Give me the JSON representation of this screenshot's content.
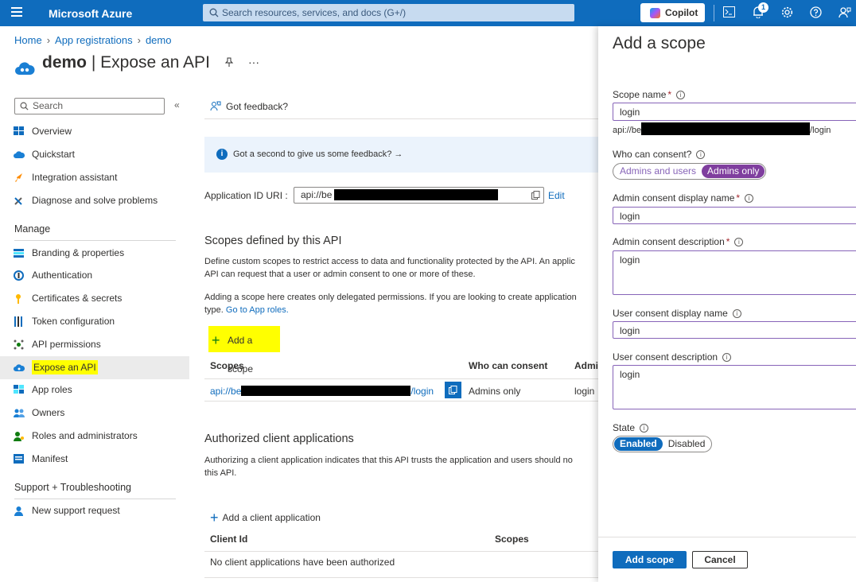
{
  "topbar": {
    "brand": "Microsoft Azure",
    "search_placeholder": "Search resources, services, and docs (G+/)",
    "copilot": "Copilot",
    "notification_count": "1"
  },
  "breadcrumb": [
    "Home",
    "App registrations",
    "demo"
  ],
  "page": {
    "title_bold": "demo",
    "title_rest": " | Expose an API"
  },
  "sidebar": {
    "search_placeholder": "Search",
    "items_top": [
      "Overview",
      "Quickstart",
      "Integration assistant",
      "Diagnose and solve problems"
    ],
    "manage_heading": "Manage",
    "manage_items": [
      "Branding & properties",
      "Authentication",
      "Certificates & secrets",
      "Token configuration",
      "API permissions",
      "Expose an API",
      "App roles",
      "Owners",
      "Roles and administrators",
      "Manifest"
    ],
    "support_heading": "Support + Troubleshooting",
    "support_items": [
      "New support request"
    ]
  },
  "main": {
    "feedback": "Got feedback?",
    "info_banner": "Got a second to give us some feedback? →",
    "app_id_label": "Application ID URI :",
    "app_id_value": "api://be",
    "edit": "Edit",
    "scopes_heading": "Scopes defined by this API",
    "scopes_desc1": "Define custom scopes to restrict access to data and functionality protected by the API. An applic",
    "scopes_desc2": "API can request that a user or admin consent to one or more of these.",
    "scopes_desc3": "Adding a scope here creates only delegated permissions. If you are looking to create application",
    "scopes_desc4_prefix": "type. ",
    "scopes_desc4_link": "Go to App roles.",
    "add_scope": "Add a scope",
    "table_headers": [
      "Scopes",
      "Who can consent",
      "Admin"
    ],
    "row_scope_prefix": "api://be",
    "row_scope_suffix": "/login",
    "row_consent": "Admins only",
    "row_admin": "login",
    "auth_heading": "Authorized client applications",
    "auth_desc1": "Authorizing a client application indicates that this API trusts the application and users should no",
    "auth_desc2": "this API.",
    "add_client": "Add a client application",
    "client_headers": [
      "Client Id",
      "Scopes"
    ],
    "client_empty": "No client applications have been authorized"
  },
  "panel": {
    "title": "Add a scope",
    "scope_name_label": "Scope name",
    "scope_name_value": "login",
    "scope_uri_prefix": "api://be",
    "scope_uri_suffix": "/login",
    "who_label": "Who can consent?",
    "who_options": [
      "Admins and users",
      "Admins only"
    ],
    "admin_display_label": "Admin consent display name",
    "admin_display_value": "login",
    "admin_desc_label": "Admin consent description",
    "admin_desc_value": "login",
    "user_display_label": "User consent display name",
    "user_display_value": "login",
    "user_desc_label": "User consent description",
    "user_desc_value": "login",
    "state_label": "State",
    "state_options": [
      "Enabled",
      "Disabled"
    ],
    "add_button": "Add scope",
    "cancel_button": "Cancel"
  }
}
